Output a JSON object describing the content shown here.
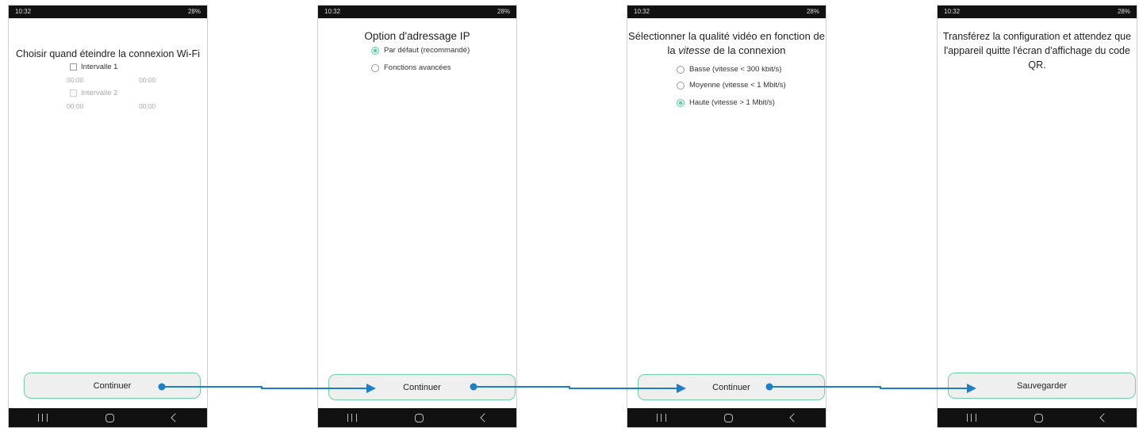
{
  "status_bar": {
    "time": "10:32",
    "battery": "28%"
  },
  "screens": [
    {
      "title": "Choisir quand éteindre la connexion Wi-Fi",
      "interval1": {
        "label": "Intervalle 1",
        "start": "00:00",
        "end": "00:00"
      },
      "interval2": {
        "label": "Intervalle 2",
        "start": "00:00",
        "end": "00:00"
      },
      "button": "Continuer"
    },
    {
      "title": "Option d'adressage IP",
      "options": [
        "Par défaut (recommandé)",
        "Fonctions avancées"
      ],
      "selected": 0,
      "button": "Continuer"
    },
    {
      "title_part1": "Sélectionner la qualité vidéo en fonction de la ",
      "title_emphasis": "vitesse",
      "title_part2": " de la connexion",
      "options": [
        "Basse (vitesse < 300 kbit/s)",
        "Moyenne (vitesse < 1 Mbit/s)",
        "Haute (vitesse > 1 Mbit/s)"
      ],
      "selected": 2,
      "button": "Continuer"
    },
    {
      "title": "Transférez la configuration et attendez que l'appareil quitte l'écran d'affichage du code QR.",
      "button": "Sauvegarder"
    }
  ],
  "colors": {
    "accent": "#5fd0a6",
    "flow_arrow": "#1f7fc4",
    "button_border": "#6fcfa8"
  }
}
